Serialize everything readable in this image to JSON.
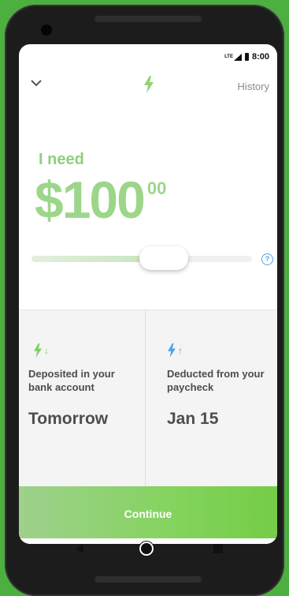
{
  "status_bar": {
    "network": "LTE",
    "time": "8:00"
  },
  "header": {
    "back_icon": "chevron-down-icon",
    "logo_icon": "lightning-bolt-icon",
    "history_label": "History"
  },
  "request": {
    "prompt": "I need",
    "amount_main": "$100",
    "amount_cents": "00",
    "slider_level": 0.6,
    "help_glyph": "?"
  },
  "info": {
    "deposit": {
      "icon": "bolt-arrow-down-icon",
      "arrow": "↓",
      "description": "Deposited in your bank account",
      "value": "Tomorrow"
    },
    "deduction": {
      "icon": "bolt-arrow-up-icon",
      "arrow": "↑",
      "description": "Deducted from your paycheck",
      "value": "Jan 15"
    }
  },
  "actions": {
    "continue_label": "Continue"
  },
  "nav": {
    "back_icon": "nav-back-icon",
    "home_icon": "nav-home-icon",
    "recents_icon": "nav-recents-icon"
  },
  "colors": {
    "accent_green": "#7dd35a",
    "amount_green": "#9dd68b",
    "help_blue": "#4da3e6",
    "text_dark": "#4d4d4d"
  }
}
